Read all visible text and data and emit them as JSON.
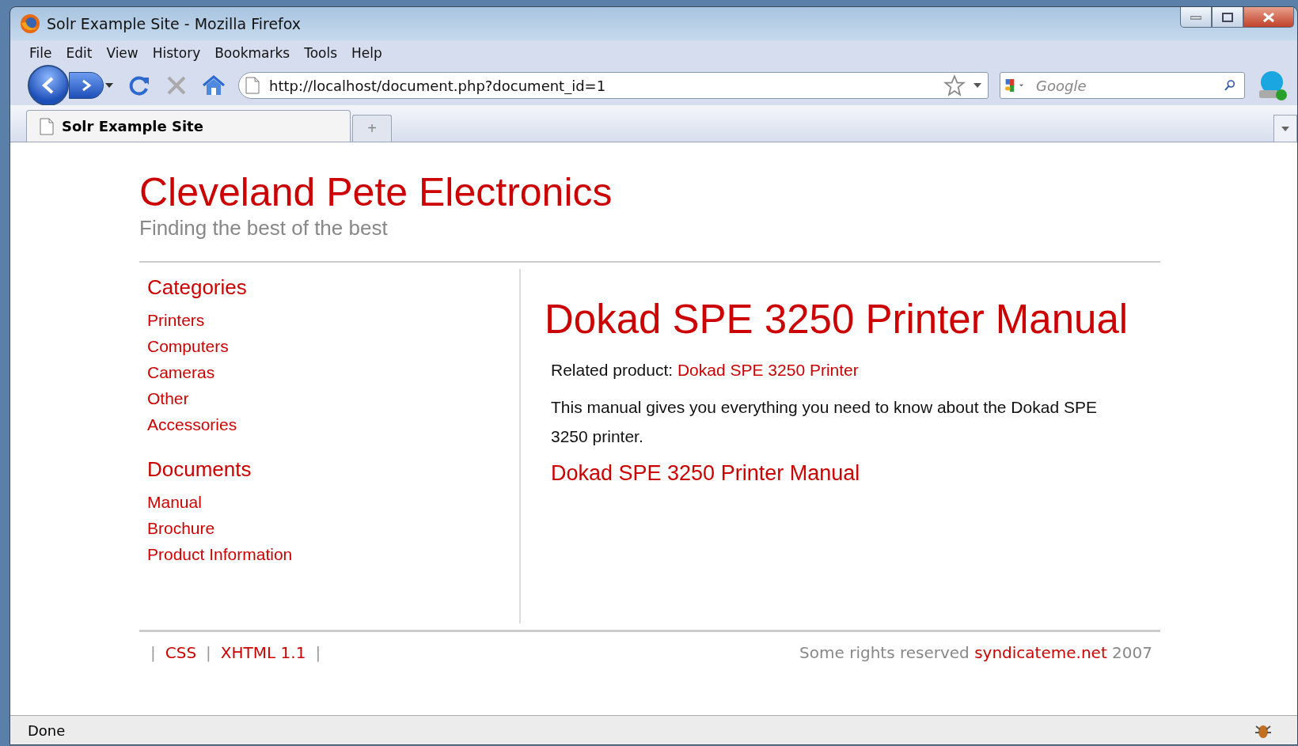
{
  "window": {
    "title": "Solr Example Site - Mozilla Firefox"
  },
  "menu": [
    "File",
    "Edit",
    "View",
    "History",
    "Bookmarks",
    "Tools",
    "Help"
  ],
  "address": {
    "value": "http://localhost/document.php?document_id=1"
  },
  "search": {
    "placeholder": "Google"
  },
  "tabs": [
    {
      "label": "Solr Example Site",
      "selected": true
    }
  ],
  "new_tab": "+",
  "site": {
    "title": "Cleveland Pete Electronics",
    "tagline": "Finding the best of the best"
  },
  "sidebar": [
    {
      "heading": "Categories",
      "items": [
        "Printers",
        "Computers",
        "Cameras",
        "Other",
        "Accessories"
      ]
    },
    {
      "heading": "Documents",
      "items": [
        "Manual",
        "Brochure",
        "Product Information"
      ]
    }
  ],
  "document": {
    "title": "Dokad SPE 3250 Printer Manual",
    "related_label": "Related product:",
    "related_link": "Dokad SPE 3250 Printer",
    "description": "This manual gives you everything you need to know about the Dokad SPE 3250 printer.",
    "file_link": "Dokad SPE 3250 Printer Manual"
  },
  "footer": {
    "left": [
      {
        "kind": "separator",
        "text": "|"
      },
      {
        "kind": "link",
        "text": "CSS"
      },
      {
        "kind": "separator",
        "text": "|"
      },
      {
        "kind": "link",
        "text": "XHTML 1.1"
      },
      {
        "kind": "separator",
        "text": "|"
      }
    ],
    "rights": "Some rights reserved",
    "rights_link": "syndicateme.net",
    "year": "2007"
  },
  "status_bar": "Done"
}
